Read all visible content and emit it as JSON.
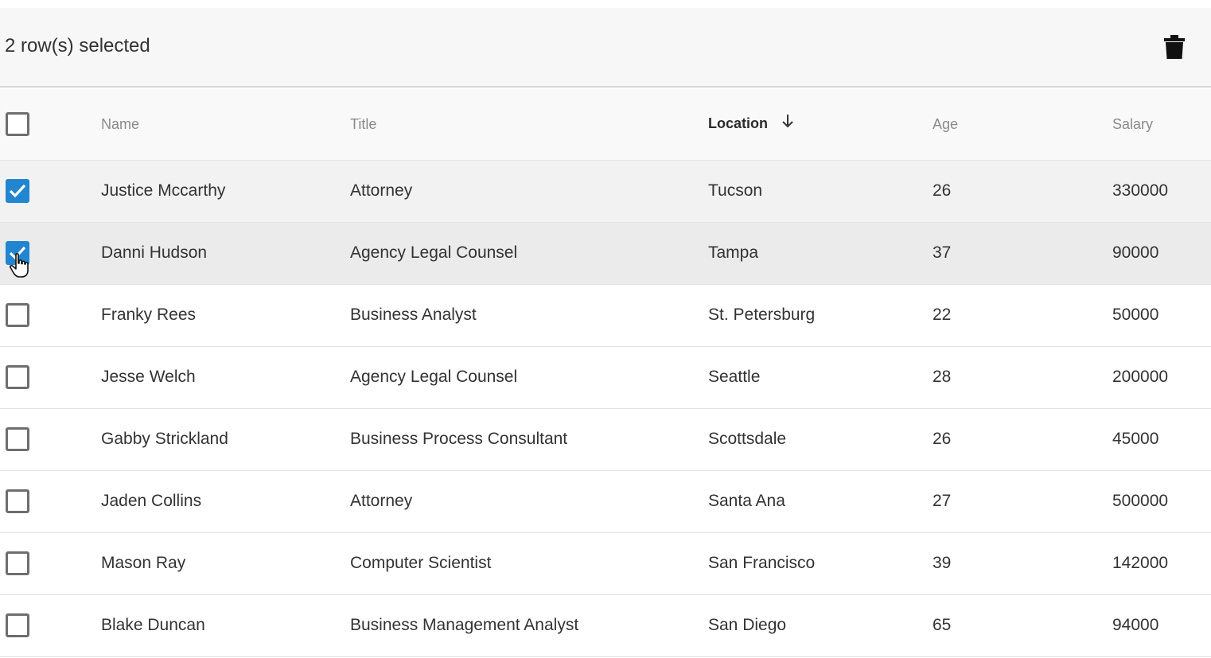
{
  "toolbar": {
    "selection_text": "2 row(s) selected",
    "delete_icon": "trash-icon"
  },
  "table": {
    "columns": [
      {
        "key": "name",
        "label": "Name",
        "sorted": false
      },
      {
        "key": "title",
        "label": "Title",
        "sorted": false
      },
      {
        "key": "location",
        "label": "Location",
        "sorted": true,
        "sort_direction": "descending"
      },
      {
        "key": "age",
        "label": "Age",
        "sorted": false
      },
      {
        "key": "salary",
        "label": "Salary",
        "sorted": false
      }
    ],
    "header_checkbox_checked": false,
    "rows": [
      {
        "checked": true,
        "name": "Justice Mccarthy",
        "title": "Attorney",
        "location": "Tucson",
        "age": "26",
        "salary": "330000"
      },
      {
        "checked": true,
        "name": "Danni Hudson",
        "title": "Agency Legal Counsel",
        "location": "Tampa",
        "age": "37",
        "salary": "90000"
      },
      {
        "checked": false,
        "name": "Franky Rees",
        "title": "Business Analyst",
        "location": "St. Petersburg",
        "age": "22",
        "salary": "50000"
      },
      {
        "checked": false,
        "name": "Jesse Welch",
        "title": "Agency Legal Counsel",
        "location": "Seattle",
        "age": "28",
        "salary": "200000"
      },
      {
        "checked": false,
        "name": "Gabby Strickland",
        "title": "Business Process Consultant",
        "location": "Scottsdale",
        "age": "26",
        "salary": "45000"
      },
      {
        "checked": false,
        "name": "Jaden Collins",
        "title": "Attorney",
        "location": "Santa Ana",
        "age": "27",
        "salary": "500000"
      },
      {
        "checked": false,
        "name": "Mason Ray",
        "title": "Computer Scientist",
        "location": "San Francisco",
        "age": "39",
        "salary": "142000"
      },
      {
        "checked": false,
        "name": "Blake Duncan",
        "title": "Business Management Analyst",
        "location": "San Diego",
        "age": "65",
        "salary": "94000"
      }
    ]
  },
  "colors": {
    "checkbox_checked": "#2185d0",
    "selected_row": "#f2f2f2",
    "toolbar_bg": "#f7f7f7"
  }
}
